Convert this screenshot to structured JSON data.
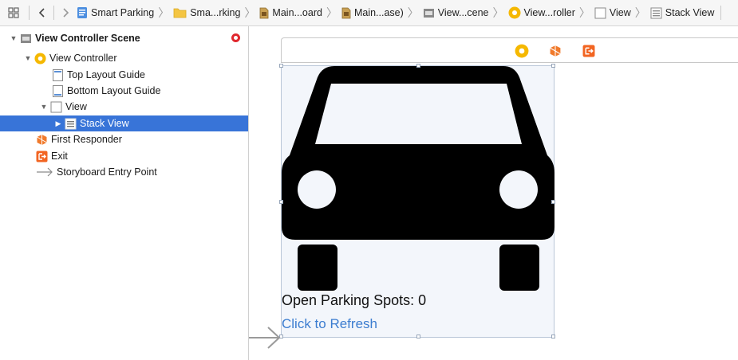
{
  "jumpbar": {
    "crumbs": [
      {
        "label": "Smart Parking",
        "icon": "project-icon"
      },
      {
        "label": "Sma...rking",
        "icon": "folder-icon"
      },
      {
        "label": "Main...oard",
        "icon": "storyboard-icon"
      },
      {
        "label": "Main...ase)",
        "icon": "storyboard-icon"
      },
      {
        "label": "View...cene",
        "icon": "scene-icon"
      },
      {
        "label": "View...roller",
        "icon": "view-controller-icon"
      },
      {
        "label": "View",
        "icon": "view-icon"
      },
      {
        "label": "Stack View",
        "icon": "stack-view-icon"
      }
    ]
  },
  "outline": {
    "scene_title": "View Controller Scene",
    "view_controller": "View Controller",
    "top_layout_guide": "Top Layout Guide",
    "bottom_layout_guide": "Bottom Layout Guide",
    "view": "View",
    "stack_view": "Stack View",
    "first_responder": "First Responder",
    "exit": "Exit",
    "entry_point": "Storyboard Entry Point"
  },
  "canvas": {
    "spots_label": "Open Parking Spots: 0",
    "refresh_link": "Click to Refresh"
  },
  "colors": {
    "selection": "#3874d8",
    "vc_yellow": "#f5b800",
    "responder_orange": "#f07a2c",
    "exit_orange": "#f26522",
    "link_blue": "#3c7dd0",
    "error_red": "#e0282e"
  }
}
